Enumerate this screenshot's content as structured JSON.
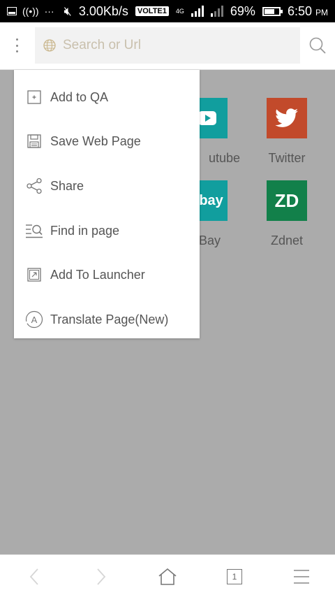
{
  "status_bar": {
    "net_speed": "3.00Kb/s",
    "volte": "VOLTE1",
    "battery": "69%",
    "time": "6:50",
    "ampm": "PM",
    "network_type": "4G"
  },
  "top_bar": {
    "search_placeholder": "Search or Url"
  },
  "shortcuts": [
    {
      "label": "utube",
      "color": "#119e9e",
      "icon": "youtube-play-icon"
    },
    {
      "label": "Twitter",
      "color": "#c24a2b",
      "icon": "twitter-bird-icon"
    },
    {
      "label": "Bay",
      "color": "#119e9e",
      "glyph": "ebay",
      "icon": "ebay-logo"
    },
    {
      "label": "Zdnet",
      "color": "#12804a",
      "glyph": "ZD",
      "icon": "zdnet-logo"
    }
  ],
  "menu": {
    "items": [
      {
        "label": "Add to QA",
        "icon": "add-box-icon"
      },
      {
        "label": "Save Web Page",
        "icon": "save-icon"
      },
      {
        "label": "Share",
        "icon": "share-icon"
      },
      {
        "label": "Find in page",
        "icon": "find-in-page-icon"
      },
      {
        "label": "Add To Launcher",
        "icon": "add-to-launcher-icon"
      },
      {
        "label": "Translate Page(New)",
        "icon": "translate-icon"
      }
    ]
  },
  "bottom_bar": {
    "tab_count": "1"
  }
}
